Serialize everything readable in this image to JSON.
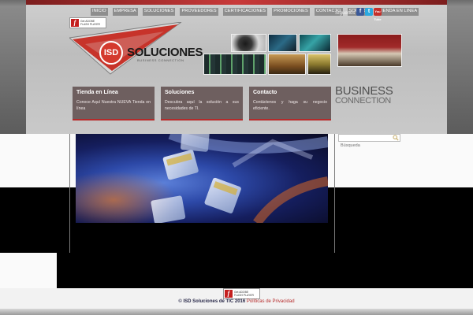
{
  "nav": {
    "items": [
      "INICIO",
      "EMPRESA",
      "SOLUCIONES",
      "PROVEEDORES",
      "CERTIFICACIONES",
      "PROMOCIONES",
      "CONTACTO",
      "SOPORTE",
      "TIENDA EN LINEA"
    ]
  },
  "social": {
    "label": "Síguenos",
    "facebook": "f",
    "twitter": "t",
    "youtube": "You Tube"
  },
  "flash": {
    "line1": "Get ADOBE",
    "line2": "FLASH PLAYER"
  },
  "logo": {
    "mark": "ISD",
    "name": "SOLUCIONES",
    "tagline": "BUSINESS CONNECTION",
    "brand_color": "#d43a2e"
  },
  "boxes": [
    {
      "title": "Tienda en Línea",
      "text": "Conoce Aquí Nuestra NUEVA Tienda en línea"
    },
    {
      "title": "Soluciones",
      "text": "Descubra aquí la solución a sus necesidades de TI."
    },
    {
      "title": "Contacto",
      "text": "Contáctenos y haga su negocio eficiente."
    }
  ],
  "business": {
    "line1": "BUSINESS",
    "line2": "CONNECTION"
  },
  "search": {
    "placeholder": "Búsqueda"
  },
  "footer": {
    "copyright": "© ISD Soluciones de TIC 2016",
    "privacy_link": "Políticas de Privacidad"
  },
  "colors": {
    "accent": "#b62a2a",
    "box_bg": "#6e5f5f"
  }
}
